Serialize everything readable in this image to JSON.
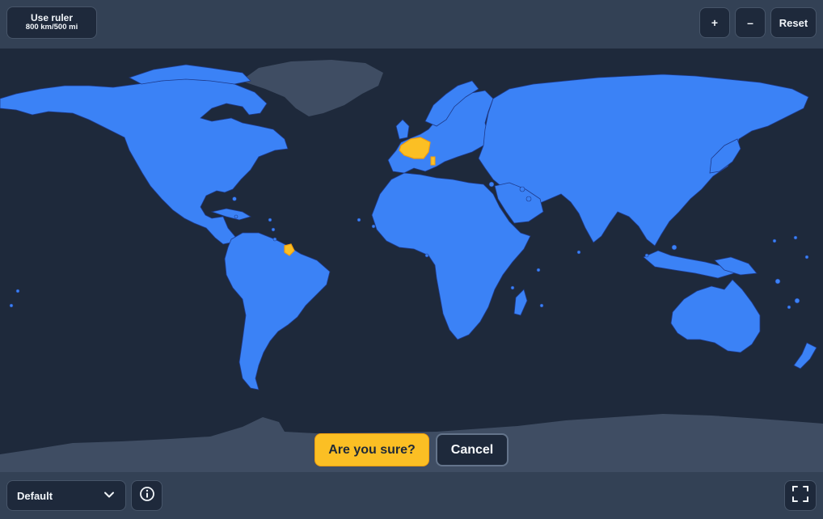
{
  "ruler": {
    "title": "Use ruler",
    "scale": "800 km/500 mi"
  },
  "zoom": {
    "in_label": "+",
    "out_label": "–",
    "reset_label": "Reset"
  },
  "confirm": {
    "question": "Are you sure?",
    "cancel": "Cancel"
  },
  "map_style": {
    "selected": "Default"
  },
  "icons": {
    "dropdown": "chevron-down-icon",
    "info": "info-icon",
    "fullscreen": "fullscreen-icon"
  },
  "highlighted_regions": [
    "France",
    "French Guiana"
  ],
  "colors": {
    "land": "#3b82f6",
    "land_border": "#1e3a8a",
    "ocean": "#1e293b",
    "unselectable_land": "#3f4d63",
    "highlight": "#fbbf24",
    "panel": "#334155"
  }
}
